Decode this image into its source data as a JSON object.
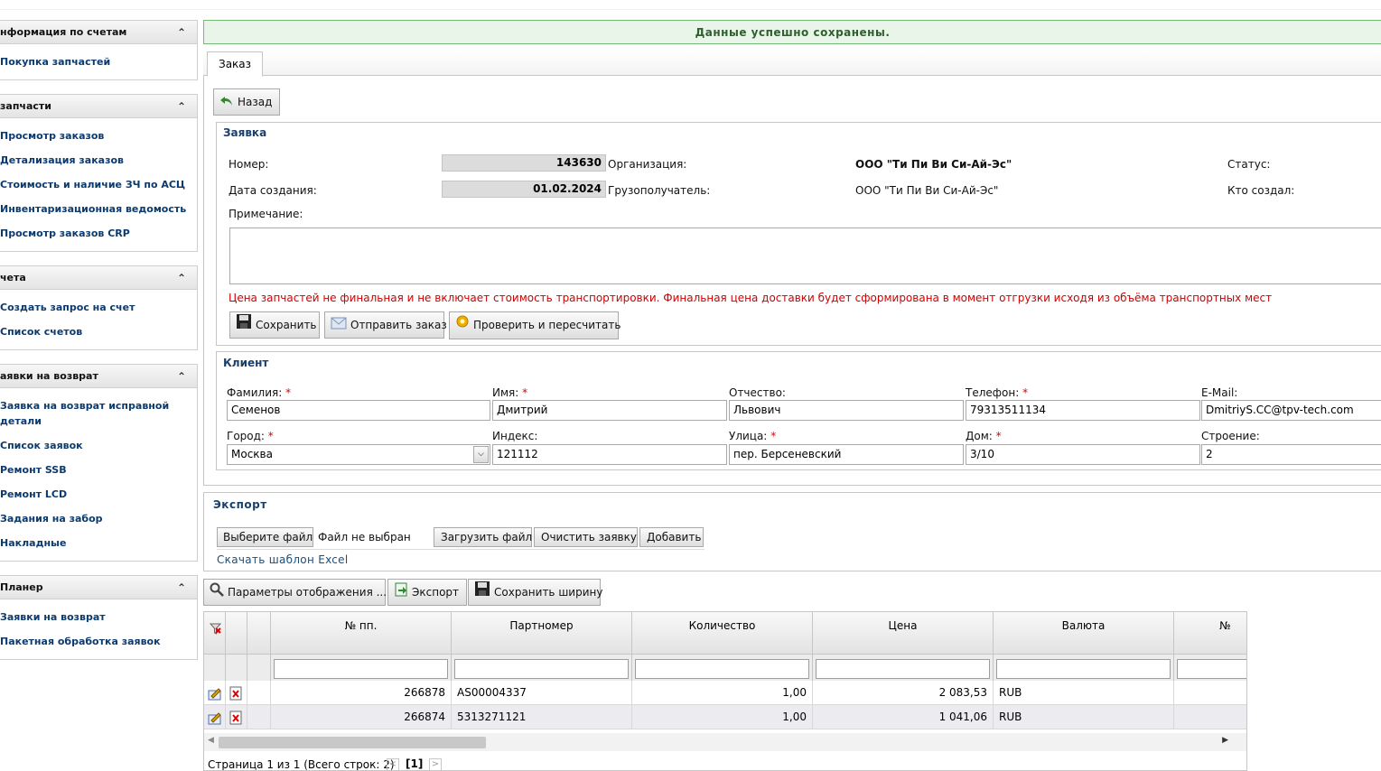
{
  "success_message": "Данные успешно сохранены.",
  "sidebar": [
    {
      "title": "нформация по счетам",
      "items": [
        "Покупка запчастей"
      ]
    },
    {
      "title": "запчасти",
      "items": [
        "Просмотр заказов",
        "Детализация заказов",
        "Стоимость и наличие ЗЧ по АСЦ",
        "Инвентаризационная ведомость",
        "Просмотр заказов CRP"
      ]
    },
    {
      "title": "чета",
      "items": [
        "Создать запрос на счет",
        "Список счетов"
      ]
    },
    {
      "title": "аявки на возврат",
      "items": [
        "Заявка на возврат исправной детали",
        "Список заявок",
        "Ремонт SSB",
        "Ремонт LCD",
        "Задания на забор",
        "Накладные"
      ]
    },
    {
      "title": "Планер",
      "items": [
        "Заявки на возврат",
        "Пакетная обработка заявок"
      ]
    }
  ],
  "tab_label": "Заказ",
  "back_button": "Назад",
  "order": {
    "legend": "Заявка",
    "number_label": "Номер:",
    "number": "143630",
    "date_label": "Дата создания:",
    "date": "01.02.2024",
    "org_label": "Организация:",
    "org": "ООО \"Ти Пи Ви Си-Ай-Эс\"",
    "consignee_label": "Грузополучатель:",
    "consignee": "ООО \"Ти Пи Ви Си-Ай-Эс\"",
    "status_label": "Статус:",
    "creator_label": "Кто создал:",
    "note_label": "Примечание:",
    "notice": "Цена запчастей не финальная и не включает стоимость транспортировки. Финальная цена доставки будет сформирована в момент отгрузки исходя из объёма транспортных мест",
    "save_button": "Сохранить",
    "send_button": "Отправить заказ",
    "recalc_button": "Проверить и пересчитать"
  },
  "client": {
    "legend": "Клиент",
    "lastname_label": "Фамилия:",
    "lastname": "Семенов",
    "firstname_label": "Имя:",
    "firstname": "Дмитрий",
    "patronymic_label": "Отчество:",
    "patronymic": "Львович",
    "phone_label": "Телефон:",
    "phone": "79313511134",
    "email_label": "E-Mail:",
    "email": "DmitriyS.CC@tpv-tech.com",
    "city_label": "Город:",
    "city": "Москва",
    "index_label": "Индекс:",
    "index": "121112",
    "street_label": "Улица:",
    "street": "пер. Берсеневский",
    "house_label": "Дом:",
    "house": "3/10",
    "building_label": "Строение:",
    "building": "2"
  },
  "export": {
    "legend": "Экспорт",
    "choose_file": "Выберите файл",
    "no_file": "Файл не выбран",
    "upload": "Загрузить файл",
    "clear": "Очистить заявку",
    "add": "Добавить",
    "template_link": "Скачать шаблон Excel"
  },
  "toolbar": {
    "display_params": "Параметры отображения ...",
    "export": "Экспорт",
    "save_width": "Сохранить ширину"
  },
  "table": {
    "columns": [
      "№ пп.",
      "Партномер",
      "Количество",
      "Цена",
      "Валюта",
      "№"
    ],
    "rows": [
      {
        "num": "266878",
        "part": "AS00004337",
        "qty": "1,00",
        "price": "2 083,53",
        "currency": "RUB"
      },
      {
        "num": "266874",
        "part": "5313271121",
        "qty": "1,00",
        "price": "1 041,06",
        "currency": "RUB"
      }
    ]
  },
  "pager": {
    "text": "Страница 1 из 1 (Всего строк: 2)",
    "current": "[1]",
    "prev": "<",
    "next": ">"
  }
}
